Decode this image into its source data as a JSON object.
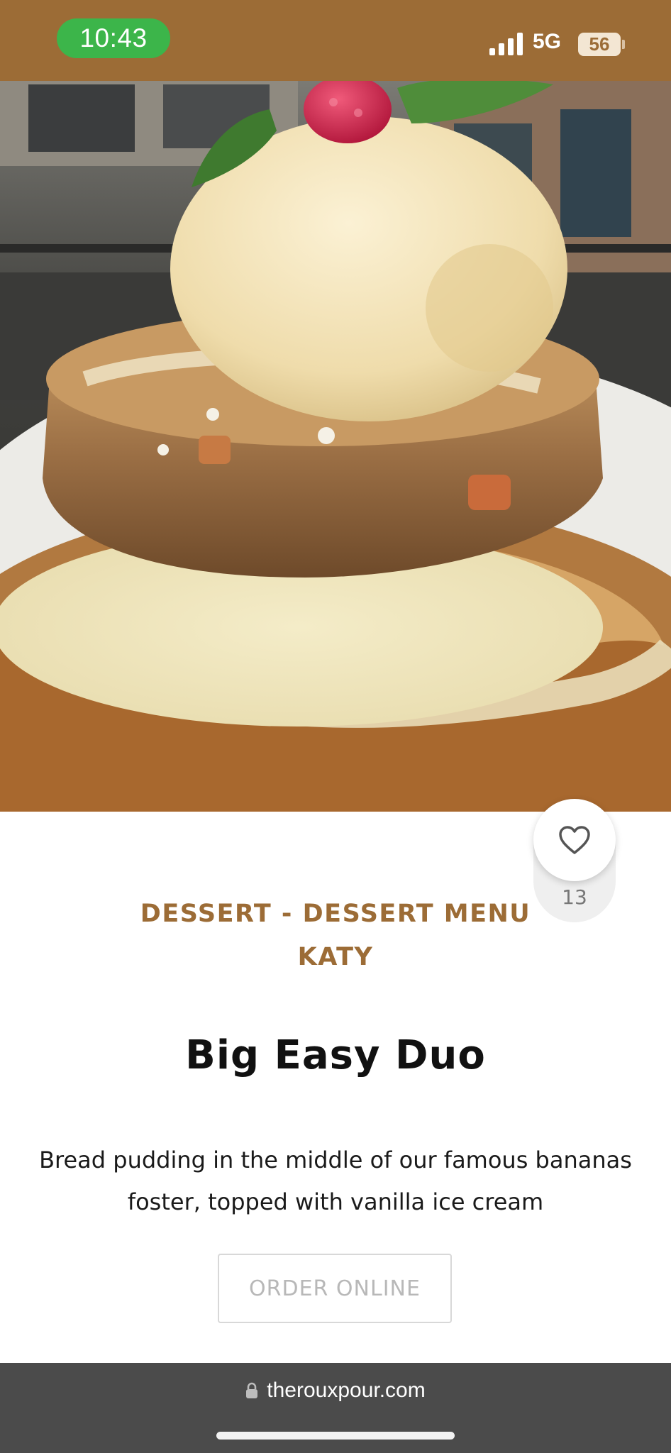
{
  "status_bar": {
    "time": "10:43",
    "network": "5G",
    "battery": "56",
    "colors": {
      "bar": "#9c6c36",
      "time_pill": "#3cb54a"
    }
  },
  "hero_image": {
    "icon": "dessert-photo",
    "alt": "Big Easy Duo"
  },
  "favorite": {
    "icon": "heart-outline-icon",
    "count": "13"
  },
  "item": {
    "category_line1": "DESSERT - DESSERT MENU",
    "category_line2": "KATY",
    "title": "Big Easy Duo",
    "description_line1": "Bread pudding in the middle of our famous bananas",
    "description_line2": "foster, topped with vanilla ice cream",
    "order_button": "ORDER ONLINE",
    "accent_color": "#9c6c36"
  },
  "browser": {
    "url": "therouxpour.com",
    "icon": "lock-icon"
  }
}
